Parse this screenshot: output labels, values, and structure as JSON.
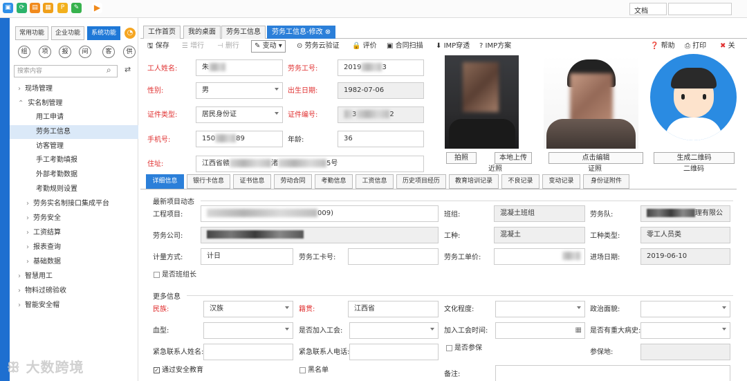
{
  "taskbar": {
    "doc_label": "文档"
  },
  "sidebar": {
    "tabs": [
      "常用功能",
      "企业功能",
      "系统功能"
    ],
    "shortcuts": [
      "组",
      "项",
      "报",
      "间",
      "客",
      "供"
    ],
    "search_placeholder": "搜索内容",
    "tree": [
      {
        "label": "现场管理",
        "arrow": "›"
      },
      {
        "label": "实名制管理",
        "arrow": "⌃"
      },
      {
        "label": "用工申请",
        "arrow": ""
      },
      {
        "label": "劳务工信息",
        "arrow": ""
      },
      {
        "label": "访客管理",
        "arrow": ""
      },
      {
        "label": "手工考勤填报",
        "arrow": ""
      },
      {
        "label": "外部考勤数据",
        "arrow": ""
      },
      {
        "label": "考勤规则设置",
        "arrow": ""
      },
      {
        "label": "劳务实名制接口集成平台",
        "arrow": "›"
      },
      {
        "label": "劳务安全",
        "arrow": "›"
      },
      {
        "label": "工资结算",
        "arrow": "›"
      },
      {
        "label": "报表查询",
        "arrow": "›"
      },
      {
        "label": "基础数据",
        "arrow": "›"
      },
      {
        "label": "智慧用工",
        "arrow": "›"
      },
      {
        "label": "物料过磅验收",
        "arrow": "›"
      },
      {
        "label": "智能安全帽",
        "arrow": "›"
      }
    ]
  },
  "page_tabs": [
    "工作首页",
    "我的桌面",
    "劳务工信息",
    "劳务工信息-修改"
  ],
  "toolbar": {
    "save": "保存",
    "add_row": "增行",
    "del_row": "删行",
    "change": "变动",
    "cloud_verify": "劳务云验证",
    "eval": "评价",
    "contract_scan": "合同扫描",
    "imp_pass": "IMP穿透",
    "imp_plan": "IMP方案",
    "help": "帮助",
    "print": "打印",
    "close": "关"
  },
  "form": {
    "name_label": "工人姓名:",
    "name_value": "朱",
    "worker_no_label": "劳务工号:",
    "worker_no_value": "2019",
    "worker_no_suffix": "3",
    "gender_label": "性别:",
    "gender_value": "男",
    "birth_label": "出生日期:",
    "birth_value": "1982-07-06",
    "idtype_label": "证件类型:",
    "idtype_value": "居民身份证",
    "idno_label": "证件编号:",
    "idno_value": "3",
    "idno_suffix": "2",
    "phone_label": "手机号:",
    "phone_value": "150",
    "phone_suffix": "89",
    "age_label": "年龄:",
    "age_value": "36",
    "addr_label": "住址:",
    "addr_value": "江西省赣",
    "addr_mid": "渚",
    "addr_suffix": "5号"
  },
  "photo_panel": {
    "take_photo": "拍照",
    "local_upload": "本地上传",
    "recent_photo": "近照",
    "click_edit": "点击编辑",
    "id_photo": "证照",
    "gen_qr": "生成二维码",
    "qr": "二维码"
  },
  "detail_tabs": [
    "详细信息",
    "银行卡信息",
    "证书信息",
    "劳动合同",
    "考勤信息",
    "工资信息",
    "历史项目经历",
    "教育培训记录",
    "不良记录",
    "变动记录",
    "身份证附件"
  ],
  "project": {
    "section_title": "最新项目动态",
    "project_label": "工程项目:",
    "project_value": "009)",
    "group_label": "班组:",
    "group_value": "混凝土班组",
    "team_label": "劳务队:",
    "team_value": "理有限公",
    "company_label": "劳务公司:",
    "trade_label": "工种:",
    "trade_value": "混凝土",
    "trade_type_label": "工种类型:",
    "trade_type_value": "零工人员类",
    "pay_method_label": "计量方式:",
    "pay_method_value": "计日",
    "card_label": "劳务工卡号:",
    "unit_price_label": "劳务工单价:",
    "entry_date_label": "进场日期:",
    "entry_date_value": "2019-06-10",
    "is_leader_label": "是否班组长"
  },
  "more": {
    "section_title": "更多信息",
    "ethnic_label": "民族:",
    "ethnic_value": "汉族",
    "native_label": "籍贯:",
    "native_value": "江西省",
    "edu_label": "文化程度:",
    "political_label": "政治面貌:",
    "blood_label": "血型:",
    "union_label": "是否加入工会:",
    "union_time_label": "加入工会时间:",
    "disease_label": "是否有重大病史:",
    "emergency_name_label": "紧急联系人姓名:",
    "emergency_phone_label": "紧急联系人电话:",
    "insured_label": "是否参保",
    "insured_place_label": "参保地:",
    "safety_edu_label": "通过安全教育",
    "blacklist_label": "黑名单",
    "remark_label": "备注:"
  },
  "watermark": "大数跨境"
}
